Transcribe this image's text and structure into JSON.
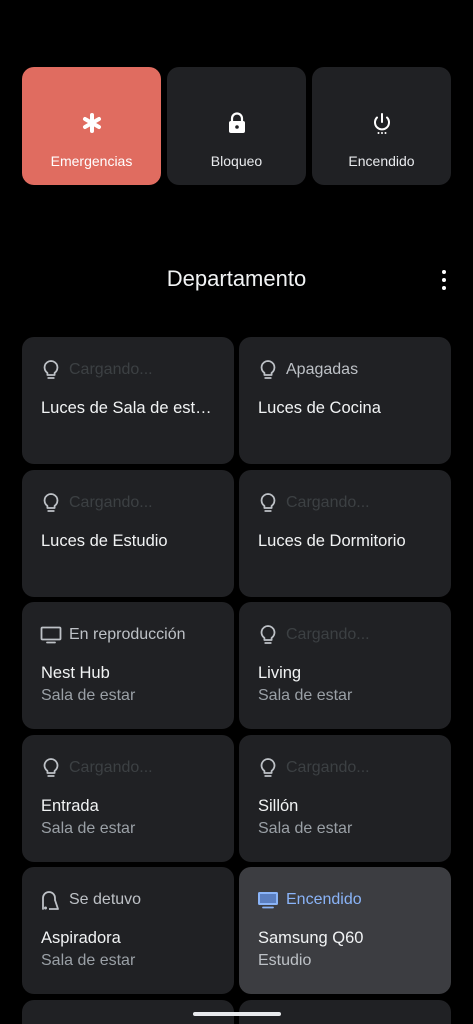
{
  "power_menu": [
    {
      "label": "Emergencias",
      "icon": "asterisk-icon"
    },
    {
      "label": "Bloqueo",
      "icon": "lock-icon"
    },
    {
      "label": "Encendido",
      "icon": "power-icon"
    }
  ],
  "header": {
    "title": "Departamento"
  },
  "tiles": [
    {
      "status": "Cargando...",
      "name": "Luces de Sala de est…",
      "room": "",
      "icon": "lightbulb-icon"
    },
    {
      "status": "Apagadas",
      "name": "Luces de Cocina",
      "room": "",
      "icon": "lightbulb-icon"
    },
    {
      "status": "Cargando...",
      "name": "Luces de Estudio",
      "room": "",
      "icon": "lightbulb-icon"
    },
    {
      "status": "Cargando...",
      "name": "Luces de Dormitorio",
      "room": "",
      "icon": "lightbulb-icon"
    },
    {
      "status": "En reproducción",
      "name": "Nest Hub",
      "room": "Sala de estar",
      "icon": "display-icon"
    },
    {
      "status": "Cargando...",
      "name": "Living",
      "room": "Sala de estar",
      "icon": "lightbulb-icon"
    },
    {
      "status": "Cargando...",
      "name": "Entrada",
      "room": "Sala de estar",
      "icon": "lightbulb-icon"
    },
    {
      "status": "Cargando...",
      "name": "Sillón",
      "room": "Sala de estar",
      "icon": "lightbulb-icon"
    },
    {
      "status": "Se detuvo",
      "name": "Aspiradora",
      "room": "Sala de estar",
      "icon": "vacuum-icon"
    },
    {
      "status": "Encendido",
      "name": "Samsung Q60",
      "room": "Estudio",
      "icon": "tv-icon"
    }
  ],
  "colors": {
    "emergency": "#e06c60",
    "tile": "#202124",
    "active_tile": "#3c3d41",
    "accent": "#8ab4f8"
  }
}
